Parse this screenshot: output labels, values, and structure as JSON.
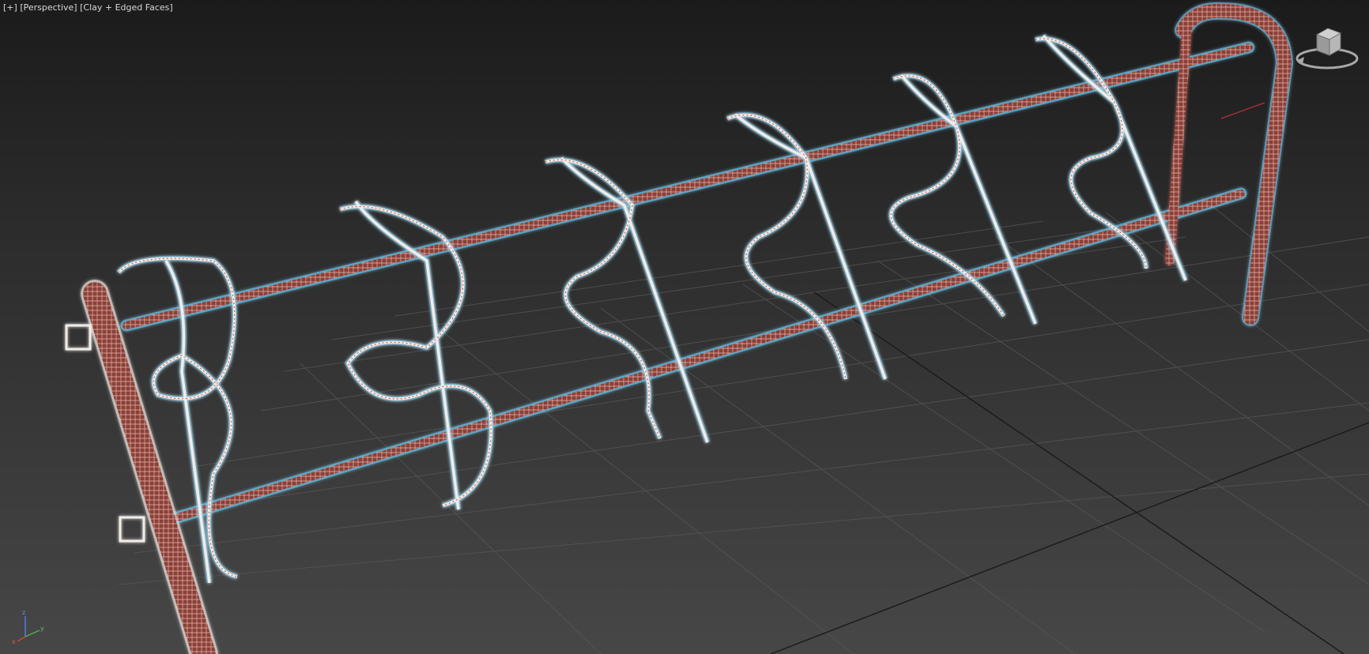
{
  "viewport": {
    "labels": {
      "plus_menu": "[+]",
      "point_of_view": "[Perspective]",
      "shading": "[Clay + Edged Faces]"
    },
    "viewcube": {
      "icon": "viewcube-icon"
    },
    "axis_tripod": {
      "icon": "axis-tripod-icon",
      "x": "x",
      "y": "y",
      "z": "z"
    },
    "colors": {
      "background_top": "#1b1b1b",
      "background_bottom": "#474747",
      "grid_line": "#575757",
      "grid_axis": "#1a1a1a",
      "frame_fill": "#8a3f38",
      "frame_highlight": "#e7b5aa",
      "hanger_wire": "#f1ece8",
      "selection_glow": "#5cc8ee"
    }
  }
}
